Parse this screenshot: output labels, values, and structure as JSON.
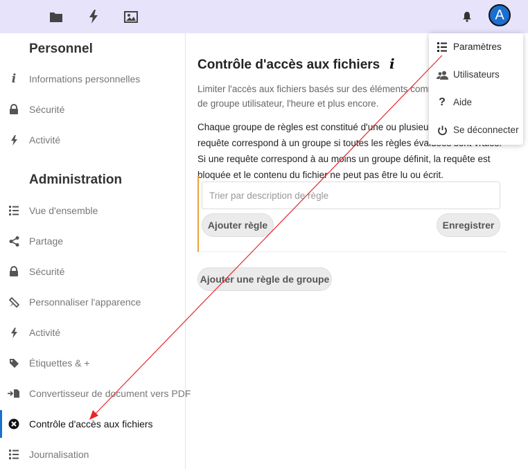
{
  "header": {
    "nav_icons": [
      "folder-icon",
      "activity-icon",
      "gallery-icon"
    ],
    "notifications_icon": "bell-icon",
    "avatar_letter": "A"
  },
  "sidebar": {
    "personal_heading": "Personnel",
    "personal_items": [
      {
        "label": "Informations personnelles",
        "icon": "info-icon"
      },
      {
        "label": "Sécurité",
        "icon": "lock-icon"
      },
      {
        "label": "Activité",
        "icon": "activity-icon"
      }
    ],
    "admin_heading": "Administration",
    "admin_items": [
      {
        "label": "Vue d'ensemble",
        "icon": "list-icon"
      },
      {
        "label": "Partage",
        "icon": "share-icon"
      },
      {
        "label": "Sécurité",
        "icon": "lock-icon"
      },
      {
        "label": "Personnaliser l'apparence",
        "icon": "brush-icon"
      },
      {
        "label": "Activité",
        "icon": "activity-icon"
      },
      {
        "label": "Étiquettes & +",
        "icon": "tag-icon"
      },
      {
        "label": "Convertisseur de document vers PDF",
        "icon": "convert-pdf-icon"
      },
      {
        "label": "Contrôle d'accès aux fichiers",
        "icon": "access-control-icon",
        "active": true
      },
      {
        "label": "Journalisation",
        "icon": "list-icon"
      }
    ]
  },
  "main": {
    "title": "Contrôle d'accès aux fichiers",
    "info_glyph": "i",
    "description": "Limiter l'accès aux fichiers basés sur des éléments comme les membres de groupe utilisateur, l'heure et plus encore.",
    "description2": "Chaque groupe de règles est constitué d'une ou plusieurs règles. Une requête correspond à un groupe si toutes les règles évaluées sont vraies. Si une requête correspond à au moins un groupe définit, la requête est bloquée et le contenu du fichier ne peut pas être lu ou écrit.",
    "filter_placeholder": "Trier par description de règle",
    "add_rule_label": "Ajouter règle",
    "save_label": "Enregistrer",
    "add_group_label": "Ajouter une règle de groupe"
  },
  "menu": {
    "items": [
      {
        "label": "Paramètres",
        "icon": "settings-list-icon",
        "active": true
      },
      {
        "label": "Utilisateurs",
        "icon": "users-icon"
      },
      {
        "label": "Aide",
        "icon": "help-icon"
      },
      {
        "label": "Se déconnecter",
        "icon": "power-icon"
      }
    ]
  },
  "colors": {
    "header_bg": "#e6e3fa",
    "accent": "#1a6fcf",
    "group_border": "#e8a33c",
    "annotation_arrow": "#e8262a"
  }
}
